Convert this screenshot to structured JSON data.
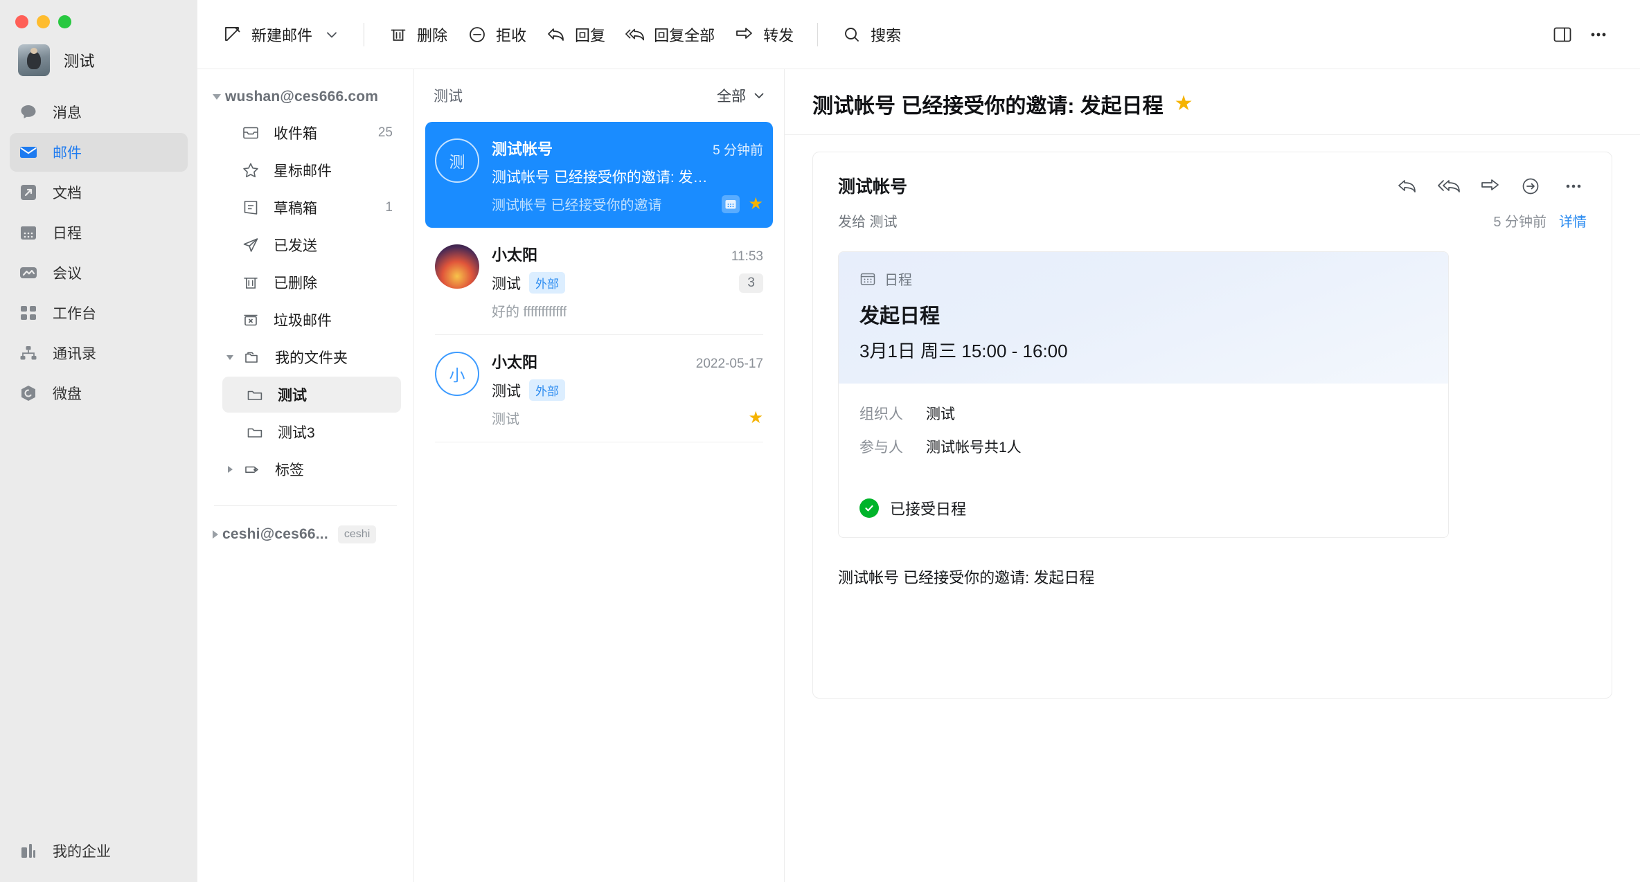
{
  "window": {
    "traffic_lights": [
      "close",
      "minimize",
      "maximize"
    ]
  },
  "rail": {
    "profile_name": "测试",
    "items": [
      {
        "label": "消息",
        "icon": "chat-icon",
        "active": false
      },
      {
        "label": "邮件",
        "icon": "mail-icon",
        "active": true
      },
      {
        "label": "文档",
        "icon": "doc-icon",
        "active": false
      },
      {
        "label": "日程",
        "icon": "calendar-icon",
        "active": false
      },
      {
        "label": "会议",
        "icon": "meeting-icon",
        "active": false
      },
      {
        "label": "工作台",
        "icon": "grid-icon",
        "active": false
      },
      {
        "label": "通讯录",
        "icon": "contacts-icon",
        "active": false
      },
      {
        "label": "微盘",
        "icon": "drive-icon",
        "active": false
      }
    ],
    "bottom": {
      "label": "我的企业",
      "icon": "company-icon"
    }
  },
  "toolbar": {
    "compose": "新建邮件",
    "delete": "删除",
    "reject": "拒收",
    "reply": "回复",
    "reply_all": "回复全部",
    "forward": "转发",
    "search": "搜索",
    "layout_icon": "layout-icon",
    "more_icon": "more-icon"
  },
  "folders": {
    "account": "wushan@ces666.com",
    "items": [
      {
        "label": "收件箱",
        "count": "25",
        "icon": "inbox-icon",
        "indent": 1,
        "selected": false
      },
      {
        "label": "星标邮件",
        "count": "",
        "icon": "star-outline-icon",
        "indent": 1,
        "selected": false
      },
      {
        "label": "草稿箱",
        "count": "1",
        "icon": "draft-icon",
        "indent": 1,
        "selected": false
      },
      {
        "label": "已发送",
        "count": "",
        "icon": "send-icon",
        "indent": 1,
        "selected": false
      },
      {
        "label": "已删除",
        "count": "",
        "icon": "trash-icon",
        "indent": 1,
        "selected": false
      },
      {
        "label": "垃圾邮件",
        "count": "",
        "icon": "spam-icon",
        "indent": 1,
        "selected": false
      },
      {
        "label": "我的文件夹",
        "count": "",
        "icon": "folder-icon",
        "indent": 1,
        "selected": false,
        "expander": "down"
      },
      {
        "label": "测试",
        "count": "",
        "icon": "folder-open-icon",
        "indent": 2,
        "selected": true
      },
      {
        "label": "测试3",
        "count": "",
        "icon": "folder-open-icon",
        "indent": 2,
        "selected": false
      },
      {
        "label": "标签",
        "count": "",
        "icon": "tag-icon",
        "indent": 1,
        "selected": false,
        "expander": "right"
      }
    ],
    "second_account": {
      "name": "ceshi@ces66...",
      "tag": "ceshi"
    }
  },
  "maillist": {
    "title": "测试",
    "filter": "全部",
    "rows": [
      {
        "avatar_text": "测",
        "avatar_style": "ring-white",
        "from": "测试帐号",
        "time": "5 分钟前",
        "subject": "测试帐号 已经接受你的邀请: 发…",
        "preview": "测试帐号 已经接受你的邀请",
        "external": "",
        "count": "",
        "has_calendar_icon": true,
        "has_star": true,
        "selected": true
      },
      {
        "avatar_text": "",
        "avatar_style": "photo",
        "from": "小太阳",
        "time": "11:53",
        "subject": "测试",
        "preview": "好的 ffffffffffff",
        "external": "外部",
        "count": "3",
        "has_calendar_icon": false,
        "has_star": false,
        "selected": false
      },
      {
        "avatar_text": "小",
        "avatar_style": "ring-blue",
        "from": "小太阳",
        "time": "2022-05-17",
        "subject": "测试",
        "preview": "测试",
        "external": "外部",
        "count": "",
        "has_calendar_icon": false,
        "has_star": true,
        "selected": false
      }
    ]
  },
  "reader": {
    "title": "测试帐号 已经接受你的邀请: 发起日程",
    "title_starred": true,
    "sender": "测试帐号",
    "to_label": "发给 测试",
    "date": "5 分钟前",
    "detail_link": "详情",
    "actions": [
      "reply-icon",
      "reply-all-icon",
      "forward-icon",
      "forward-to-icon",
      "more-icon"
    ],
    "calendar_card": {
      "kind_label": "日程",
      "kind_icon": "calendar-icon",
      "title": "发起日程",
      "when": "3月1日 周三 15:00 - 16:00",
      "rows": [
        {
          "key": "组织人",
          "value": "测试"
        },
        {
          "key": "参与人",
          "value": "测试帐号共1人"
        }
      ],
      "status": "已接受日程",
      "status_icon": "check-circle-icon"
    },
    "body_text": "测试帐号 已经接受你的邀请: 发起日程"
  },
  "colors": {
    "accent": "#1a8cff",
    "star": "#f5b301",
    "success": "#00b42a",
    "rail_bg": "#ebebeb",
    "link": "#2d8cf0"
  }
}
